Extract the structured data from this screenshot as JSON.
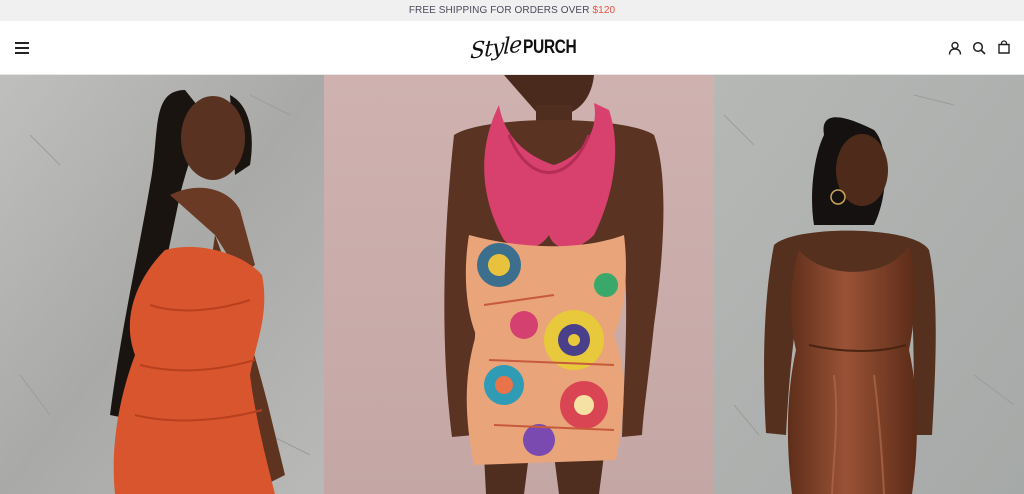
{
  "announcement": {
    "text": "FREE SHIPPING FOR ORDERS OVER",
    "price": "$120"
  },
  "header": {
    "logo_script": "Style",
    "logo_word": "PURCH",
    "icons": [
      "menu-icon",
      "account-icon",
      "search-icon",
      "cart-icon"
    ]
  },
  "hero": {
    "images": [
      {
        "name": "model-orange-dress",
        "dress_color": "#d9552e"
      },
      {
        "name": "model-floral-halter-dress",
        "dress_color": "#d8406e"
      },
      {
        "name": "model-brown-leather-dress",
        "dress_color": "#7a3d24"
      }
    ]
  },
  "colors": {
    "announce_bg": "#f0f0f0",
    "announce_text": "#4a4a5c",
    "accent_price": "#e8553f"
  }
}
